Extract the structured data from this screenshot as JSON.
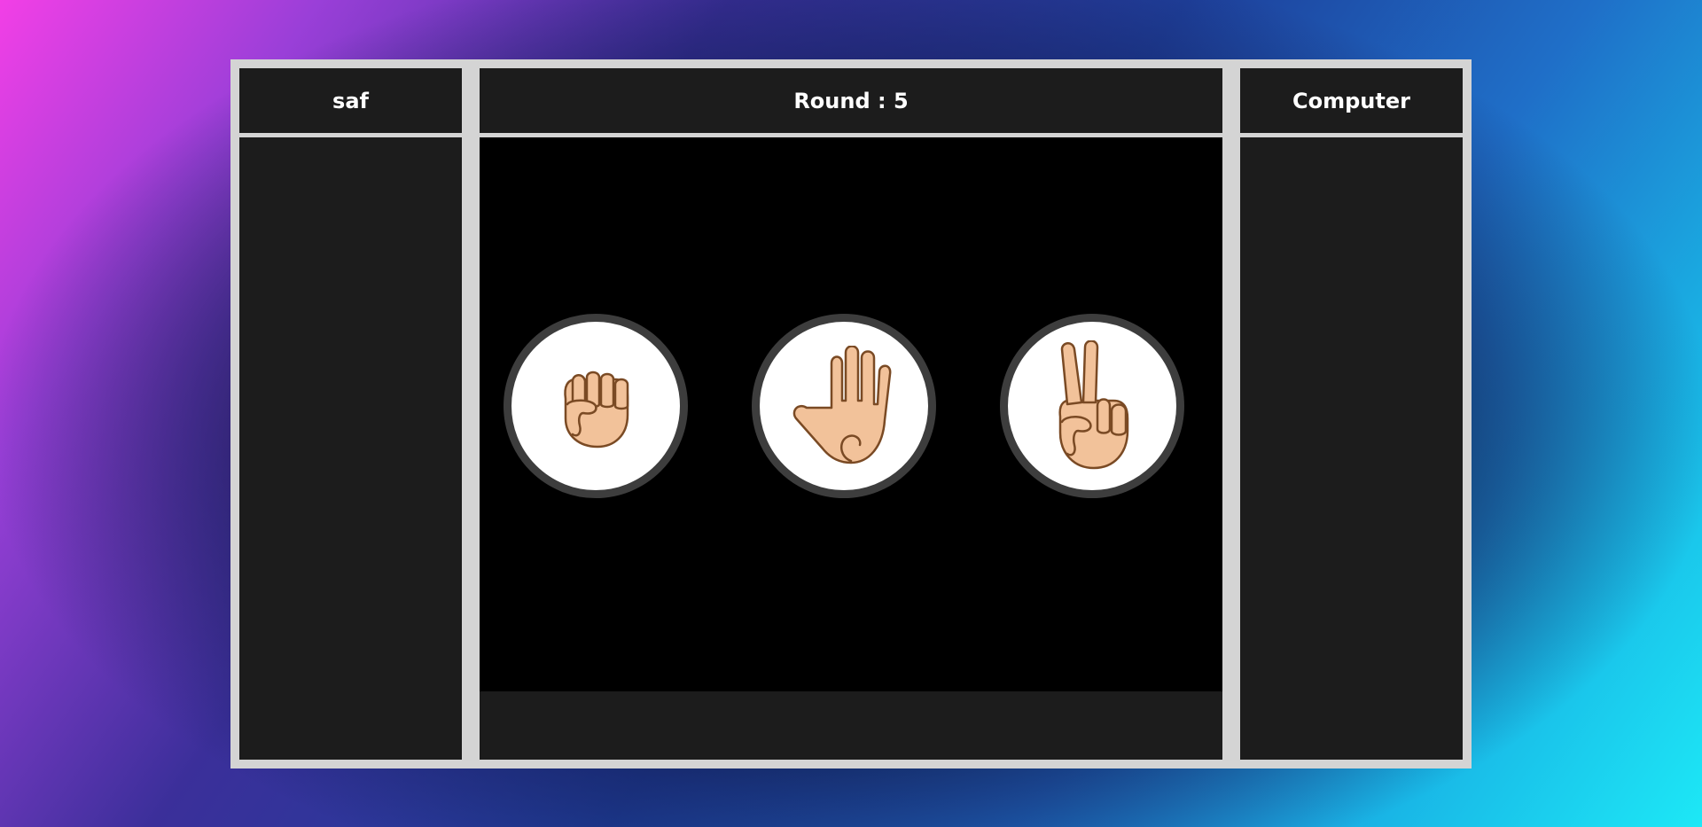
{
  "player": {
    "name": "saf"
  },
  "round": {
    "text": "Round : 5"
  },
  "computer": {
    "name": "Computer"
  },
  "choices": [
    {
      "id": "rock",
      "icon": "fist-icon"
    },
    {
      "id": "paper",
      "icon": "open-hand-icon"
    },
    {
      "id": "scissors",
      "icon": "victory-hand-icon"
    }
  ],
  "colors": {
    "frame": "#d4d4d4",
    "panel": "#1c1c1c",
    "arena": "#000000",
    "choice_ring": "#3d3d3d",
    "skin": "#f2c29a",
    "skin_outline": "#7a4a24"
  }
}
